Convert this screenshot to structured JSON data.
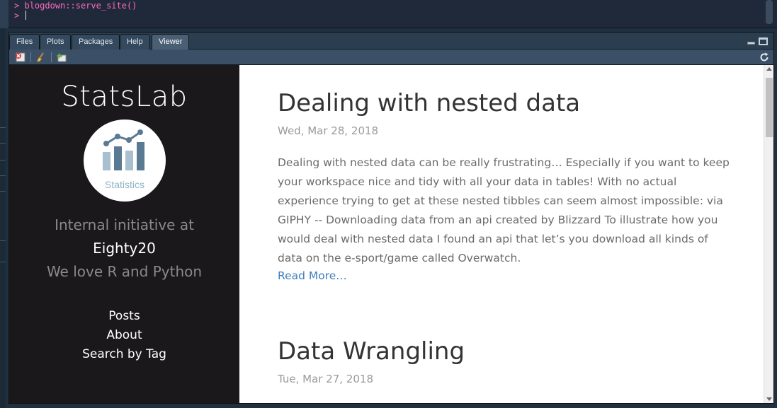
{
  "console": {
    "command_prompt": ">",
    "command": "blogdown::serve_site()",
    "input_prompt": ">"
  },
  "pane": {
    "tabs": [
      {
        "label": "Files"
      },
      {
        "label": "Plots"
      },
      {
        "label": "Packages"
      },
      {
        "label": "Help"
      },
      {
        "label": "Viewer"
      }
    ],
    "active_tab": "Viewer",
    "toolbar_icons": [
      "remove-viewer-icon",
      "clear-all-icon",
      "export-icon",
      "refresh-icon"
    ]
  },
  "site": {
    "title": "StatsLab",
    "logo_text": "Statistics",
    "tagline_prefix": "Internal initiative at",
    "company": "Eighty20",
    "tagline_suffix": "We love R and Python",
    "nav": [
      "Posts",
      "About",
      "Search by Tag"
    ]
  },
  "posts": [
    {
      "title": "Dealing with nested data",
      "date": "Wed, Mar 28, 2018",
      "excerpt": "Dealing with nested data can be really frustrating… Especially if you want to keep your workspace nice and tidy with all your data in tables! With no actual experience trying to get at these nested tibbles can seem almost impossible: via GIPHY -- Downloading data from an api created by Blizzard To illustrate how you would deal with nested data I found an api that let’s you download all kinds of data on the e-sport/game called Overwatch.",
      "read_more": "Read More…"
    },
    {
      "title": "Data Wrangling",
      "date": "Tue, Mar 27, 2018"
    }
  ],
  "colors": {
    "sidebar_bg": "#1b181c",
    "link": "#3d7ebf",
    "console_text": "#ff6ac1",
    "logo_bars": "#5a7a93"
  }
}
